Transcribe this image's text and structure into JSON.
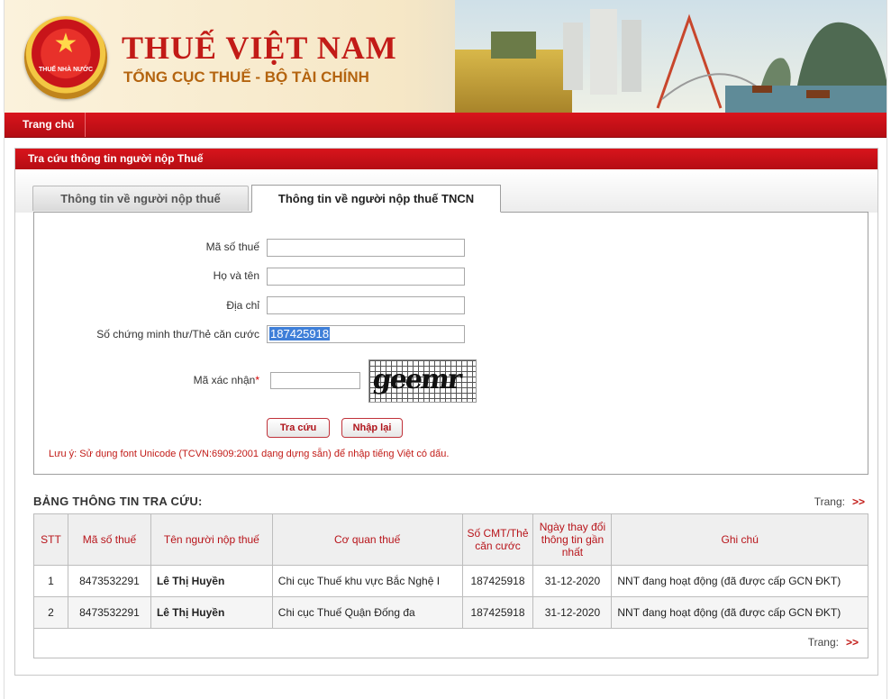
{
  "header": {
    "emblem_text": "THUẾ NHÀ NƯỚC",
    "title": "THUẾ VIỆT NAM",
    "subtitle": "TỔNG CỤC THUẾ - BỘ TÀI CHÍNH"
  },
  "nav": {
    "items": [
      {
        "label": "Trang chủ"
      }
    ]
  },
  "panel": {
    "title": "Tra cứu thông tin người nộp Thuế",
    "tabs": [
      {
        "label": "Thông tin về người nộp thuế",
        "active": false
      },
      {
        "label": "Thông tin về người nộp thuế TNCN",
        "active": true
      }
    ]
  },
  "form": {
    "tax_code": {
      "label": "Mã số thuế",
      "value": ""
    },
    "full_name": {
      "label": "Họ và tên",
      "value": ""
    },
    "address": {
      "label": "Địa chỉ",
      "value": ""
    },
    "id_number": {
      "label": "Số chứng minh thư/Thẻ căn cước",
      "value": "187425918"
    },
    "captcha": {
      "label": "Mã xác nhận",
      "required_mark": "*",
      "value": "",
      "image_text": "geemr"
    },
    "search_button": "Tra cứu",
    "reset_button": "Nhập lại",
    "note": "Lưu ý: Sử dụng font Unicode (TCVN:6909:2001 dạng dựng sẵn) để nhập tiếng Việt có dấu."
  },
  "results": {
    "title": "BẢNG THÔNG TIN TRA CỨU:",
    "pager_label": "Trang:",
    "pager_next": ">>",
    "columns": [
      "STT",
      "Mã số thuế",
      "Tên người nộp thuế",
      "Cơ quan thuế",
      "Số CMT/Thẻ căn cước",
      "Ngày thay đổi thông tin gần nhất",
      "Ghi chú"
    ],
    "rows": [
      [
        "1",
        "8473532291",
        "Lê Thị Huyền",
        "Chi cục Thuế khu vực Bắc Nghệ I",
        "187425918",
        "31-12-2020",
        "NNT đang hoạt động (đã được cấp GCN ĐKT)"
      ],
      [
        "2",
        "8473532291",
        "Lê Thị Huyền",
        "Chi cục Thuế Quận Đống đa",
        "187425918",
        "31-12-2020",
        "NNT đang hoạt động (đã được cấp GCN ĐKT)"
      ]
    ]
  },
  "colors": {
    "brand_red": "#c21b17",
    "nav_red": "#d9141c",
    "selection_blue": "#3f7fd8"
  }
}
